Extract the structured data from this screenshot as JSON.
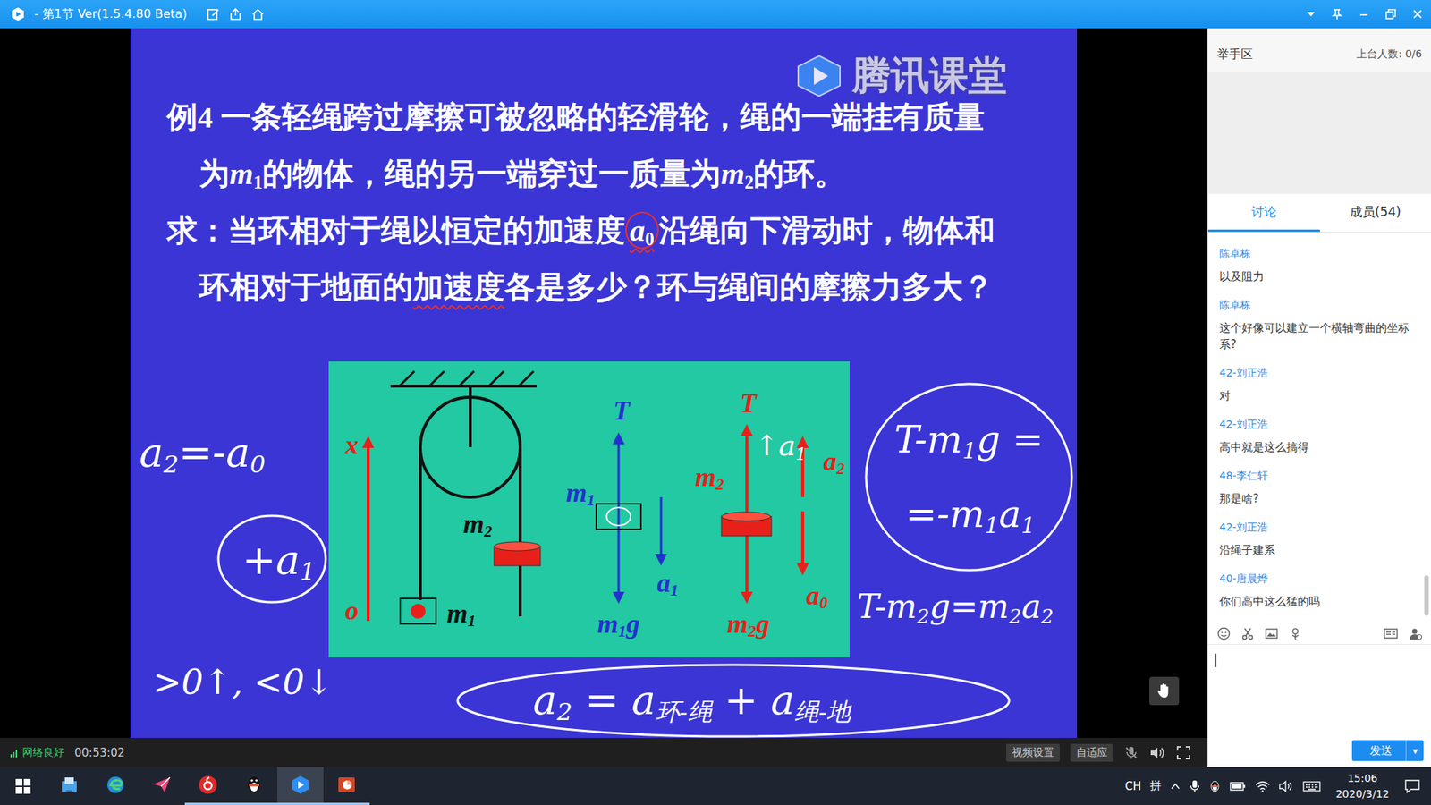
{
  "window": {
    "title": "- 第1节 Ver(1.5.4.80 Beta)"
  },
  "slide": {
    "watermark": "腾讯课堂",
    "lines": [
      {
        "kind": "lead",
        "segments": [
          {
            "text": "例4 一条轻绳跨过摩擦可被忽略的轻滑轮，绳的一端挂有质量",
            "circled": false,
            "wavy": false
          }
        ]
      },
      {
        "kind": "cont",
        "segments": [
          {
            "text": "为",
            "circled": false,
            "wavy": false
          },
          {
            "text": "m",
            "sub": "1",
            "circled": false,
            "wavy": false
          },
          {
            "text": "的物体，绳的另一端穿过一质量为",
            "circled": false,
            "wavy": false
          },
          {
            "text": "m",
            "sub": "2",
            "circled": false,
            "wavy": false
          },
          {
            "text": "的环。",
            "circled": false,
            "wavy": false
          }
        ]
      },
      {
        "kind": "lead",
        "segments": [
          {
            "text": "求：当环相对于绳以恒定的加速度",
            "circled": false,
            "wavy": false
          },
          {
            "text": "a",
            "sub": "0",
            "circled": true,
            "wavy": true
          },
          {
            "text": "沿绳向下滑动时，物体和",
            "circled": false,
            "wavy": false
          }
        ]
      },
      {
        "kind": "cont",
        "segments": [
          {
            "text": "环相对于地面的",
            "circled": false,
            "wavy": false
          },
          {
            "text": "加速度",
            "circled": false,
            "wavy": true
          },
          {
            "text": "各是多少？环与绳间的摩擦力多大？",
            "circled": false,
            "wavy": false
          }
        ]
      }
    ],
    "diagram": {
      "labels": [
        {
          "text": "x",
          "color": "#e8201a"
        },
        {
          "text": "o",
          "color": "#e8201a"
        },
        {
          "text": "m",
          "sub": "2",
          "color": "#111111"
        },
        {
          "text": "m",
          "sub": "1",
          "color": "#111111"
        },
        {
          "text": "T",
          "color": "#2233cc"
        },
        {
          "text": "m",
          "sub": "1",
          "color": "#2233cc"
        },
        {
          "text": "a",
          "sub": "1",
          "color": "#2233cc"
        },
        {
          "text": "m",
          "sub": "1",
          "after": "g",
          "color": "#2233cc"
        },
        {
          "text": "T",
          "color": "#e8201a"
        },
        {
          "text": "m",
          "sub": "2",
          "color": "#e8201a"
        },
        {
          "text": "a",
          "sub": "2",
          "color": "#e8201a"
        },
        {
          "text": "a",
          "sub": "0",
          "color": "#e8201a"
        },
        {
          "text": "m",
          "sub": "2",
          "after": "g",
          "color": "#e8201a"
        }
      ]
    },
    "notes": [
      {
        "segments": [
          {
            "text": "a",
            "sub": false
          },
          {
            "text": "2",
            "sub": true
          },
          {
            "text": "=-a",
            "sub": false
          },
          {
            "text": "0",
            "sub": true
          }
        ]
      },
      {
        "segments": [
          {
            "text": "+a",
            "sub": false
          },
          {
            "text": "1",
            "sub": true
          }
        ]
      },
      {
        "segments": [
          {
            "text": ">0↑, <0↓",
            "sub": false
          }
        ]
      },
      {
        "segments": [
          {
            "text": "T-m",
            "sub": false
          },
          {
            "text": "1",
            "sub": true
          },
          {
            "text": "g =",
            "sub": false
          }
        ]
      },
      {
        "segments": [
          {
            "text": "=-m",
            "sub": false
          },
          {
            "text": "1",
            "sub": true
          },
          {
            "text": "a",
            "sub": false
          },
          {
            "text": "1",
            "sub": true
          }
        ]
      },
      {
        "segments": [
          {
            "text": "T-m",
            "sub": false
          },
          {
            "text": "2",
            "sub": true
          },
          {
            "text": "g=m",
            "sub": false
          },
          {
            "text": "2",
            "sub": true
          },
          {
            "text": "a",
            "sub": false
          },
          {
            "text": "2",
            "sub": true
          }
        ]
      },
      {
        "segments": [
          {
            "text": "a",
            "sub": false
          },
          {
            "text": "2",
            "sub": true
          },
          {
            "text": " = a",
            "sub": false
          },
          {
            "text": "环-绳",
            "sub": true
          },
          {
            "text": " + a",
            "sub": false
          },
          {
            "text": "绳-地",
            "sub": true
          }
        ]
      },
      {
        "segments": [
          {
            "text": "↑a",
            "sub": false
          },
          {
            "text": "1",
            "sub": true
          }
        ]
      }
    ]
  },
  "video_bar": {
    "network": "网络良好",
    "time": "00:53:02",
    "buttons": [
      "视频设置",
      "自适应"
    ],
    "mic_muted": true
  },
  "side": {
    "hands": {
      "title": "举手区",
      "count": "上台人数: 0/6"
    },
    "tabs": [
      {
        "label": "讨论",
        "selected": true
      },
      {
        "label": "成员(54)",
        "selected": false
      }
    ],
    "messages": [
      {
        "name": "陈卓栋",
        "text": "以及阻力"
      },
      {
        "name": "陈卓栋",
        "text": "这个好像可以建立一个横轴弯曲的坐标系?"
      },
      {
        "name": "42-刘正浩",
        "text": "对"
      },
      {
        "name": "42-刘正浩",
        "text": "高中就是这么搞得"
      },
      {
        "name": "48-李仁轩",
        "text": "那是啥?"
      },
      {
        "name": "42-刘正浩",
        "text": "沿绳子建系"
      },
      {
        "name": "40-唐晨烨",
        "text": "你们高中这么猛的吗"
      }
    ],
    "send": {
      "label": "发送",
      "menu": "▾"
    }
  },
  "taskbar": {
    "apps": [
      {
        "kind": "files",
        "active": false,
        "selected": false
      },
      {
        "kind": "edge",
        "active": false,
        "selected": false
      },
      {
        "kind": "feishu",
        "active": false,
        "selected": false
      },
      {
        "kind": "netease",
        "active": true,
        "selected": false
      },
      {
        "kind": "qq",
        "active": true,
        "selected": false
      },
      {
        "kind": "tencent-class",
        "active": true,
        "selected": true
      },
      {
        "kind": "ppt",
        "active": true,
        "selected": false
      }
    ],
    "tray": {
      "lang": "CH",
      "ime": "拼",
      "time": "15:06",
      "date": "2020/3/12"
    }
  }
}
